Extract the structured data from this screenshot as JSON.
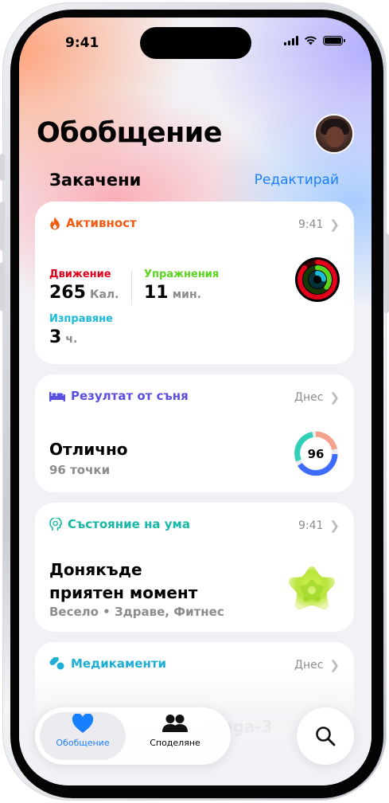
{
  "status": {
    "time": "9:41"
  },
  "header": {
    "title": "Обобщение"
  },
  "pinned": {
    "title": "Закачени",
    "edit_label": "Редактирай"
  },
  "cards": {
    "activity": {
      "title": "Активност",
      "time": "9:41",
      "move_label": "Движение",
      "move_value": "265",
      "move_unit": "Кал.",
      "exercise_label": "Упражнения",
      "exercise_value": "11",
      "exercise_unit": "мин.",
      "stand_label": "Изправяне",
      "stand_value": "3",
      "stand_unit": "ч.",
      "colors": {
        "move": "#e2001a",
        "exercise": "#5ad41f",
        "stand": "#1bbbd8"
      }
    },
    "sleep": {
      "title": "Резултат от съня",
      "time": "Днес",
      "result": "Отлично",
      "points": "96 точки",
      "score": "96"
    },
    "mind": {
      "title": "Състояние на ума",
      "time": "9:41",
      "line1": "Донякъде",
      "line2": "приятен момент",
      "details": "Весело • Здраве, Фитнес"
    },
    "meds": {
      "title": "Медикаменти",
      "time": "Днес",
      "item_partial": "mega-3"
    }
  },
  "tabbar": {
    "summary_label": "Обобщение",
    "sharing_label": "Споделяне"
  },
  "icons": [
    "flame-icon",
    "bed-icon",
    "head-icon",
    "pills-icon",
    "heart-icon",
    "people-icon",
    "search-icon",
    "chevron-right-icon"
  ]
}
